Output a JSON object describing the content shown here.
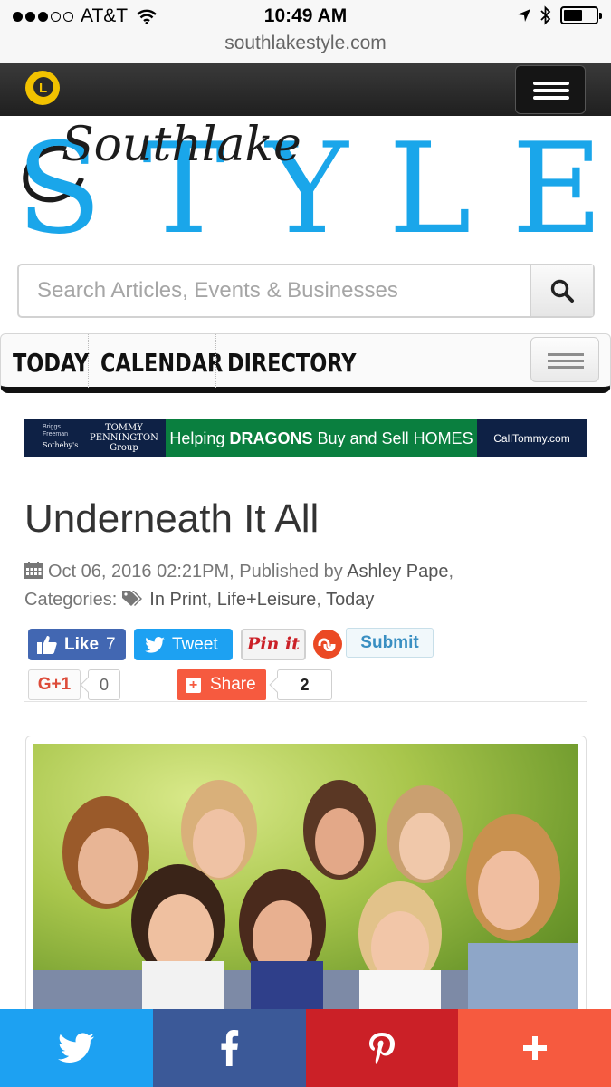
{
  "status_bar": {
    "carrier": "AT&T",
    "time": "10:49 AM",
    "url": "southlakestyle.com",
    "battery_level": 0.6
  },
  "site": {
    "logo_letter": "L",
    "masthead_script": "Southlake",
    "masthead_letters": [
      "S",
      "T",
      "Y",
      "L",
      "E"
    ]
  },
  "search": {
    "placeholder": "Search Articles, Events & Businesses"
  },
  "nav": {
    "tabs": [
      "TODAY",
      "CALENDAR",
      "DIRECTORY"
    ]
  },
  "ad": {
    "brand_line1": "Briggs",
    "brand_line2": "Freeman",
    "brand_line3": "Sotheby's",
    "agent_line1": "TOMMY",
    "agent_line2": "PENNINGTON",
    "agent_line3": "Group",
    "tagline_pre": "Helping",
    "tagline_bold": "DRAGONS",
    "tagline_post": "Buy and Sell HOMES",
    "website": "CallTommy.com"
  },
  "article": {
    "title": "Underneath It All",
    "date": "Oct 06, 2016 02:21PM, Published by",
    "author": "Ashley Pape",
    "categories_label": "Categories:",
    "categories": [
      "In Print",
      "Life+Leisure",
      "Today"
    ]
  },
  "social": {
    "like_label": "Like",
    "like_count": "7",
    "tweet_label": "Tweet",
    "pin_label": "Pin it",
    "submit_label": "Submit",
    "gplus_label": "G+1",
    "gplus_count": "0",
    "share_label": "Share",
    "share_count": "2"
  },
  "colors": {
    "style_blue": "#1aa6ea",
    "twitter": "#1da1f2",
    "facebook": "#3b5998",
    "pinterest": "#cb2027",
    "share_orange": "#f65a3f"
  }
}
